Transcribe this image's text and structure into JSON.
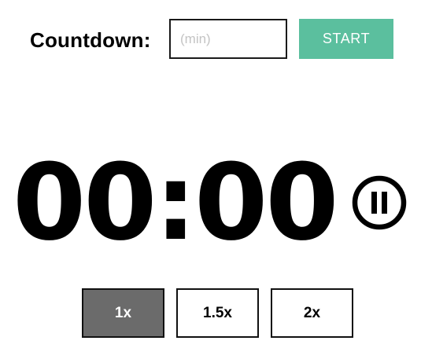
{
  "countdown": {
    "label": "Countdown:",
    "input_value": "",
    "input_placeholder": "(min)",
    "start_label": "START"
  },
  "timer": {
    "display": "00:00",
    "control_icon": "pause-circle-icon"
  },
  "speeds": [
    {
      "label": "1x",
      "selected": true
    },
    {
      "label": "1.5x",
      "selected": false
    },
    {
      "label": "2x",
      "selected": false
    }
  ],
  "colors": {
    "accent": "#5bbf9e",
    "active_speed_bg": "#6b6b6b",
    "border": "#111111",
    "placeholder": "#c4c4c4"
  }
}
